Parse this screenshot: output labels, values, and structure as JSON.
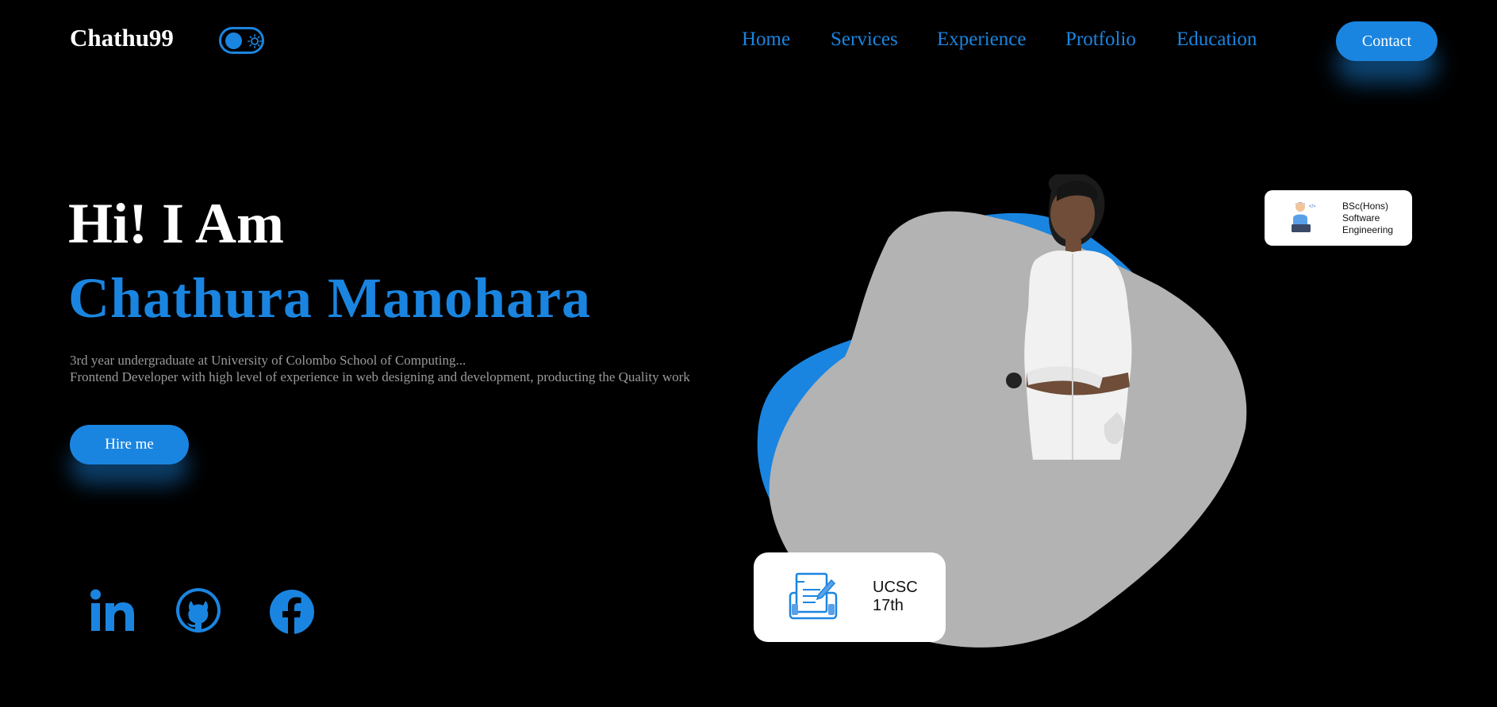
{
  "header": {
    "logo": "Chathu99",
    "nav": [
      "Home",
      "Services",
      "Experience",
      "Protfolio",
      "Education"
    ],
    "contact_label": "Contact",
    "theme_toggle_icon": "sun-icon"
  },
  "hero": {
    "greeting": "Hi! I Am",
    "name": "Chathura Manohara",
    "desc_line1": "3rd year undergraduate at University of Colombo School of Computing...",
    "desc_line2": "Frontend Developer with high level of experience in web designing and development, producting the Quality work",
    "hire_label": "Hire me"
  },
  "social": [
    "linkedin-icon",
    "github-icon",
    "facebook-icon"
  ],
  "cards": {
    "degree": [
      "BSc(Hons)",
      "Software",
      "Engineering"
    ],
    "batch": [
      "UCSC",
      "17th"
    ]
  },
  "colors": {
    "accent": "#1a85e0",
    "background": "#000000",
    "blob": "#b3b3b3"
  }
}
